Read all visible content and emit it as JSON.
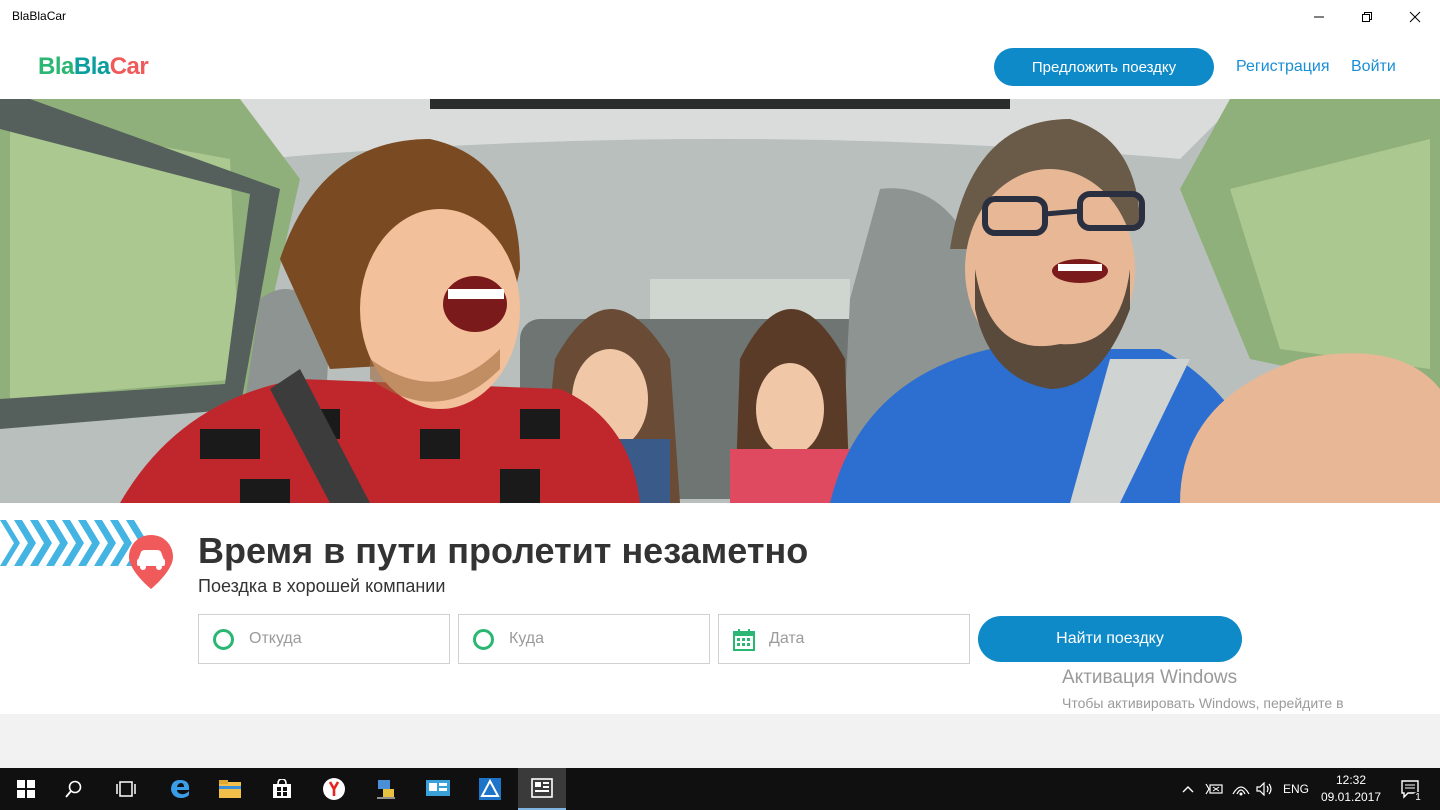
{
  "window": {
    "title": "BlaBlaCar",
    "controls": {
      "minimize_icon": "minimize-icon",
      "restore_icon": "restore-icon",
      "close_icon": "close-icon"
    }
  },
  "header": {
    "logo": {
      "part1": "Bla",
      "part2": "Bla",
      "part3": "Car"
    },
    "offer_ride_label": "Предложить поездку",
    "register_label": "Регистрация",
    "login_label": "Войти"
  },
  "hero": {
    "image_subject": "friends-in-car-photo"
  },
  "search": {
    "headline": "Время в пути пролетит незаметно",
    "subheadline": "Поездка в хорошей компании",
    "from_placeholder": "Откуда",
    "to_placeholder": "Куда",
    "date_placeholder": "Дата",
    "find_label": "Найти поездку"
  },
  "watermark": {
    "title": "Активация Windows",
    "text": "Чтобы активировать Windows, перейдите в раздел \"Параметры\"."
  },
  "taskbar": {
    "apps": [
      "start-icon",
      "search-icon",
      "task-view-icon",
      "edge-icon",
      "file-explorer-icon",
      "store-icon",
      "yandex-browser-icon",
      "network-app-icon",
      "control-panel-icon",
      "azure-app-icon",
      "blablacar-app-icon"
    ],
    "language": "ENG",
    "time": "12:32",
    "date": "09.01.2017",
    "notifications_count": "1"
  },
  "colors": {
    "brand_blue": "#0f8ac9",
    "link_blue": "#1a8ed6",
    "green": "#2bb673",
    "red": "#f05a5a",
    "stripe_blue": "#44b5e3"
  }
}
